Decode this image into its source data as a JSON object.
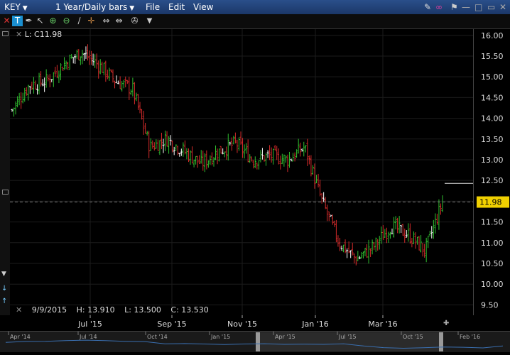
{
  "window": {
    "symbol": "KEY",
    "period": "1 Year/Daily bars",
    "menus": [
      "File",
      "Edit",
      "View"
    ]
  },
  "legend": {
    "text": "L: C11.98"
  },
  "readout": {
    "date": "9/9/2015",
    "high": "H: 13.910",
    "low": "L: 13.500",
    "close": "C: 13.530"
  },
  "last_price_badge": "11.98",
  "colors": {
    "up": "#2fbf2f",
    "down": "#d42a2a",
    "doji": "#ffffff",
    "badge": "#f0d000",
    "background": "#000000"
  },
  "chart_data": {
    "type": "ohlc",
    "y_ticks": [
      "16.00",
      "15.50",
      "15.00",
      "14.50",
      "14.00",
      "13.50",
      "13.00",
      "12.50",
      "12.00",
      "11.50",
      "11.00",
      "10.50",
      "10.00",
      "9.50"
    ],
    "x_ticks": [
      "Jul '15",
      "Sep '15",
      "Nov '15",
      "Jan '16",
      "Mar '16"
    ],
    "ylim": [
      9.25,
      16.15
    ],
    "last_close": 11.98,
    "reference_line": 12.43,
    "close_path": [
      [
        "May '15",
        14.2
      ],
      [
        "May '15",
        14.8
      ],
      [
        "Jun '15",
        14.9
      ],
      [
        "Jun '15",
        15.3
      ],
      [
        "Jul '15",
        15.6
      ],
      [
        "Jul '15",
        15.3
      ],
      [
        "Aug '15",
        14.9
      ],
      [
        "Aug '15",
        14.7
      ],
      [
        "Aug '15",
        13.3
      ],
      [
        "Sep '15",
        13.5
      ],
      [
        "Sep '15",
        13.2
      ],
      [
        "Oct '15",
        12.9
      ],
      [
        "Oct '15",
        13.2
      ],
      [
        "Nov '15",
        13.4
      ],
      [
        "Nov '15",
        13.0
      ],
      [
        "Dec '15",
        13.1
      ],
      [
        "Dec '15",
        13.0
      ],
      [
        "Jan '16",
        13.3
      ],
      [
        "Jan '16",
        12.0
      ],
      [
        "Feb '16",
        11.0
      ],
      [
        "Feb '16",
        10.6
      ],
      [
        "Mar '16",
        10.9
      ],
      [
        "Mar '16",
        11.4
      ],
      [
        "Apr '16",
        11.2
      ],
      [
        "Apr '16",
        10.8
      ],
      [
        "May '16",
        11.98
      ]
    ]
  },
  "navigator": {
    "labels": [
      "Apr '14",
      "Jul '14",
      "Oct '14",
      "Jan '15",
      "Apr '15",
      "Jul '15",
      "Oct '15",
      "Feb '16"
    ]
  }
}
